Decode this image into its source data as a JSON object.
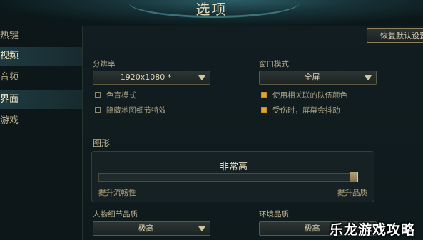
{
  "window": {
    "title": "选项"
  },
  "sidebar": {
    "items": [
      {
        "label": "热键",
        "active": false
      },
      {
        "label": "视频",
        "active": true
      },
      {
        "label": "音频",
        "active": false
      },
      {
        "label": "界面",
        "active": false
      },
      {
        "label": "游戏",
        "active": false
      }
    ]
  },
  "toolbar": {
    "reset_label": "恢复默认设置"
  },
  "resolution": {
    "label": "分辨率",
    "value": "1920x1080 *"
  },
  "window_mode": {
    "label": "窗口模式",
    "value": "全屏"
  },
  "left_options": [
    {
      "label": "色盲模式",
      "checked": false
    },
    {
      "label": "隐藏地图细节特效",
      "checked": false
    }
  ],
  "right_options": [
    {
      "label": "使用相关联的队伍颜色",
      "checked": true
    },
    {
      "label": "受伤时，屏幕会抖动",
      "checked": true
    }
  ],
  "graphics": {
    "section_label": "图形",
    "quality_label": "非常高",
    "slider_min_label": "提升流畅性",
    "slider_max_label": "提升品质",
    "slider_level": 1.0
  },
  "character_quality": {
    "label": "人物细节品质",
    "value": "极高"
  },
  "environment_quality": {
    "label": "环境品质",
    "value": "极高"
  },
  "watermark": {
    "text": "乐龙游戏攻略"
  },
  "colors": {
    "accent": "#e0a533",
    "border": "#8f815d",
    "text": "#c0b494"
  }
}
